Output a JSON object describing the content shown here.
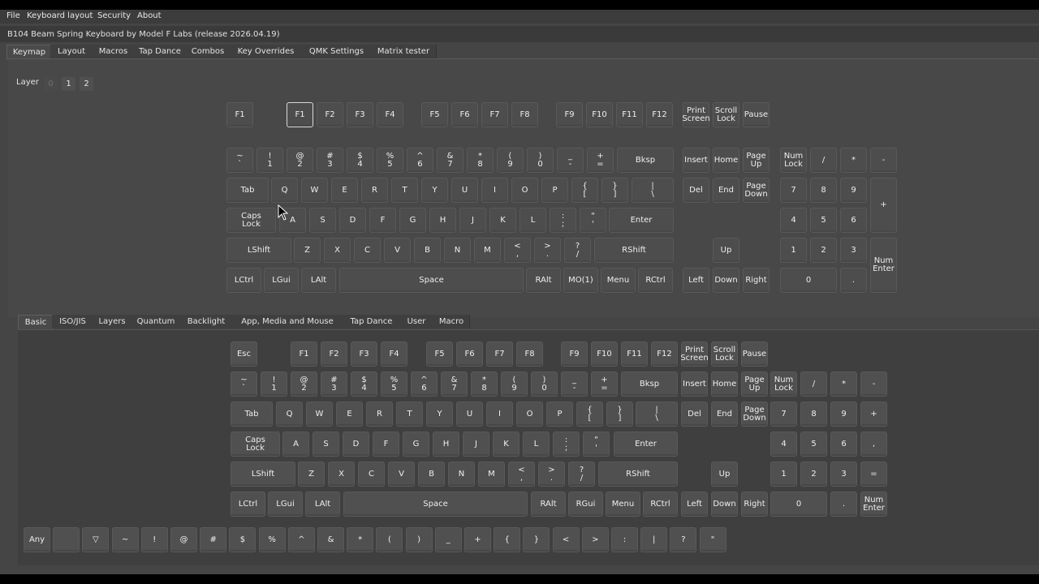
{
  "menu": [
    "File",
    "Keyboard layout",
    "Security",
    "About"
  ],
  "title": "B104 Beam Spring Keyboard by Model F Labs (release 2026.04.19)",
  "top_tabs": [
    "Keymap",
    "Layout",
    "Macros",
    "Tap Dance",
    "Combos",
    "Key Overrides",
    "QMK Settings",
    "Matrix tester"
  ],
  "active_top_tab": "Keymap",
  "layer": {
    "label": "Layer",
    "options": [
      "0",
      "1",
      "2"
    ],
    "selected": "0"
  },
  "keymap": [
    {
      "label": "F1"
    },
    {
      "label": "F1",
      "selected": true
    },
    {
      "label": "F2"
    },
    {
      "label": "F3"
    },
    {
      "label": "F4"
    },
    {
      "label": "F5"
    },
    {
      "label": "F6"
    },
    {
      "label": "F7"
    },
    {
      "label": "F8"
    },
    {
      "label": "F9"
    },
    {
      "label": "F10"
    },
    {
      "label": "F11"
    },
    {
      "label": "F12"
    },
    {
      "label": "Print\nScreen"
    },
    {
      "label": "Scroll\nLock"
    },
    {
      "label": "Pause"
    },
    {
      "label": "~\n`"
    },
    {
      "label": "!\n1"
    },
    {
      "label": "@\n2"
    },
    {
      "label": "#\n3"
    },
    {
      "label": "$\n4"
    },
    {
      "label": "%\n5"
    },
    {
      "label": "^\n6"
    },
    {
      "label": "&\n7"
    },
    {
      "label": "*\n8"
    },
    {
      "label": "(\n9"
    },
    {
      "label": ")\n0"
    },
    {
      "label": "_\n-"
    },
    {
      "label": "+\n="
    },
    {
      "label": "Bksp"
    },
    {
      "label": "Insert"
    },
    {
      "label": "Home"
    },
    {
      "label": "Page\nUp"
    },
    {
      "label": "Num\nLock"
    },
    {
      "label": "/"
    },
    {
      "label": "*"
    },
    {
      "label": "-"
    },
    {
      "label": "Tab"
    },
    {
      "label": "Q"
    },
    {
      "label": "W"
    },
    {
      "label": "E"
    },
    {
      "label": "R"
    },
    {
      "label": "T"
    },
    {
      "label": "Y"
    },
    {
      "label": "U"
    },
    {
      "label": "I"
    },
    {
      "label": "O"
    },
    {
      "label": "P"
    },
    {
      "label": "{\n["
    },
    {
      "label": "}\n]"
    },
    {
      "label": "|\n\\"
    },
    {
      "label": "Del"
    },
    {
      "label": "End"
    },
    {
      "label": "Page\nDown"
    },
    {
      "label": "7"
    },
    {
      "label": "8"
    },
    {
      "label": "9"
    },
    {
      "label": "+"
    },
    {
      "label": "Caps\nLock"
    },
    {
      "label": "A"
    },
    {
      "label": "S"
    },
    {
      "label": "D"
    },
    {
      "label": "F"
    },
    {
      "label": "G"
    },
    {
      "label": "H"
    },
    {
      "label": "J"
    },
    {
      "label": "K"
    },
    {
      "label": "L"
    },
    {
      "label": ":\n;"
    },
    {
      "label": "\"\n'"
    },
    {
      "label": "Enter"
    },
    {
      "label": "4"
    },
    {
      "label": "5"
    },
    {
      "label": "6"
    },
    {
      "label": "LShift"
    },
    {
      "label": "Z"
    },
    {
      "label": "X"
    },
    {
      "label": "C"
    },
    {
      "label": "V"
    },
    {
      "label": "B"
    },
    {
      "label": "N"
    },
    {
      "label": "M"
    },
    {
      "label": "<\n,"
    },
    {
      "label": ">\n."
    },
    {
      "label": "?\n/"
    },
    {
      "label": "RShift"
    },
    {
      "label": "Up"
    },
    {
      "label": "1"
    },
    {
      "label": "2"
    },
    {
      "label": "3"
    },
    {
      "label": "Num\nEnter"
    },
    {
      "label": "LCtrl"
    },
    {
      "label": "LGui"
    },
    {
      "label": "LAlt"
    },
    {
      "label": "Space"
    },
    {
      "label": "RAlt"
    },
    {
      "label": "MO(1)"
    },
    {
      "label": "Menu"
    },
    {
      "label": "RCtrl"
    },
    {
      "label": "Left"
    },
    {
      "label": "Down"
    },
    {
      "label": "Right"
    },
    {
      "label": "0"
    },
    {
      "label": "."
    }
  ],
  "bottom_tabs": [
    "Basic",
    "ISO/JIS",
    "Layers",
    "Quantum",
    "Backlight",
    "App, Media and Mouse",
    "Tap Dance",
    "User",
    "Macro"
  ],
  "active_bottom_tab": "Basic",
  "palette": [
    {
      "label": "Esc"
    },
    {
      "label": "F1"
    },
    {
      "label": "F2"
    },
    {
      "label": "F3"
    },
    {
      "label": "F4"
    },
    {
      "label": "F5"
    },
    {
      "label": "F6"
    },
    {
      "label": "F7"
    },
    {
      "label": "F8"
    },
    {
      "label": "F9"
    },
    {
      "label": "F10"
    },
    {
      "label": "F11"
    },
    {
      "label": "F12"
    },
    {
      "label": "Print\nScreen"
    },
    {
      "label": "Scroll\nLock"
    },
    {
      "label": "Pause"
    },
    {
      "label": "~\n`"
    },
    {
      "label": "!\n1"
    },
    {
      "label": "@\n2"
    },
    {
      "label": "#\n3"
    },
    {
      "label": "$\n4"
    },
    {
      "label": "%\n5"
    },
    {
      "label": "^\n6"
    },
    {
      "label": "&\n7"
    },
    {
      "label": "*\n8"
    },
    {
      "label": "(\n9"
    },
    {
      "label": ")\n0"
    },
    {
      "label": "_\n-"
    },
    {
      "label": "+\n="
    },
    {
      "label": "Bksp"
    },
    {
      "label": "Insert"
    },
    {
      "label": "Home"
    },
    {
      "label": "Page\nUp"
    },
    {
      "label": "Num\nLock"
    },
    {
      "label": "/"
    },
    {
      "label": "*"
    },
    {
      "label": "-"
    },
    {
      "label": "Tab"
    },
    {
      "label": "Q"
    },
    {
      "label": "W"
    },
    {
      "label": "E"
    },
    {
      "label": "R"
    },
    {
      "label": "T"
    },
    {
      "label": "Y"
    },
    {
      "label": "U"
    },
    {
      "label": "I"
    },
    {
      "label": "O"
    },
    {
      "label": "P"
    },
    {
      "label": "{\n["
    },
    {
      "label": "}\n]"
    },
    {
      "label": "|\n\\"
    },
    {
      "label": "Del"
    },
    {
      "label": "End"
    },
    {
      "label": "Page\nDown"
    },
    {
      "label": "7"
    },
    {
      "label": "8"
    },
    {
      "label": "9"
    },
    {
      "label": "+"
    },
    {
      "label": "Caps\nLock"
    },
    {
      "label": "A"
    },
    {
      "label": "S"
    },
    {
      "label": "D"
    },
    {
      "label": "F"
    },
    {
      "label": "G"
    },
    {
      "label": "H"
    },
    {
      "label": "J"
    },
    {
      "label": "K"
    },
    {
      "label": "L"
    },
    {
      "label": ":\n;"
    },
    {
      "label": "\"\n'"
    },
    {
      "label": "Enter"
    },
    {
      "label": "4"
    },
    {
      "label": "5"
    },
    {
      "label": "6"
    },
    {
      "label": ","
    },
    {
      "label": "LShift"
    },
    {
      "label": "Z"
    },
    {
      "label": "X"
    },
    {
      "label": "C"
    },
    {
      "label": "V"
    },
    {
      "label": "B"
    },
    {
      "label": "N"
    },
    {
      "label": "M"
    },
    {
      "label": "<\n,"
    },
    {
      "label": ">\n."
    },
    {
      "label": "?\n/"
    },
    {
      "label": "RShift"
    },
    {
      "label": "Up"
    },
    {
      "label": "1"
    },
    {
      "label": "2"
    },
    {
      "label": "3"
    },
    {
      "label": "="
    },
    {
      "label": "LCtrl"
    },
    {
      "label": "LGui"
    },
    {
      "label": "LAlt"
    },
    {
      "label": "Space"
    },
    {
      "label": "RAlt"
    },
    {
      "label": "RGui"
    },
    {
      "label": "Menu"
    },
    {
      "label": "RCtrl"
    },
    {
      "label": "Left"
    },
    {
      "label": "Down"
    },
    {
      "label": "Right"
    },
    {
      "label": "0"
    },
    {
      "label": "."
    },
    {
      "label": "Num\nEnter"
    }
  ],
  "symbols": [
    "Any",
    "",
    "▽",
    "~",
    "!",
    "@",
    "#",
    "$",
    "%",
    "^",
    "&",
    "*",
    "(",
    ")",
    "_",
    "+",
    "{",
    "}",
    "<",
    ">",
    ":",
    "|",
    "?",
    "\""
  ]
}
